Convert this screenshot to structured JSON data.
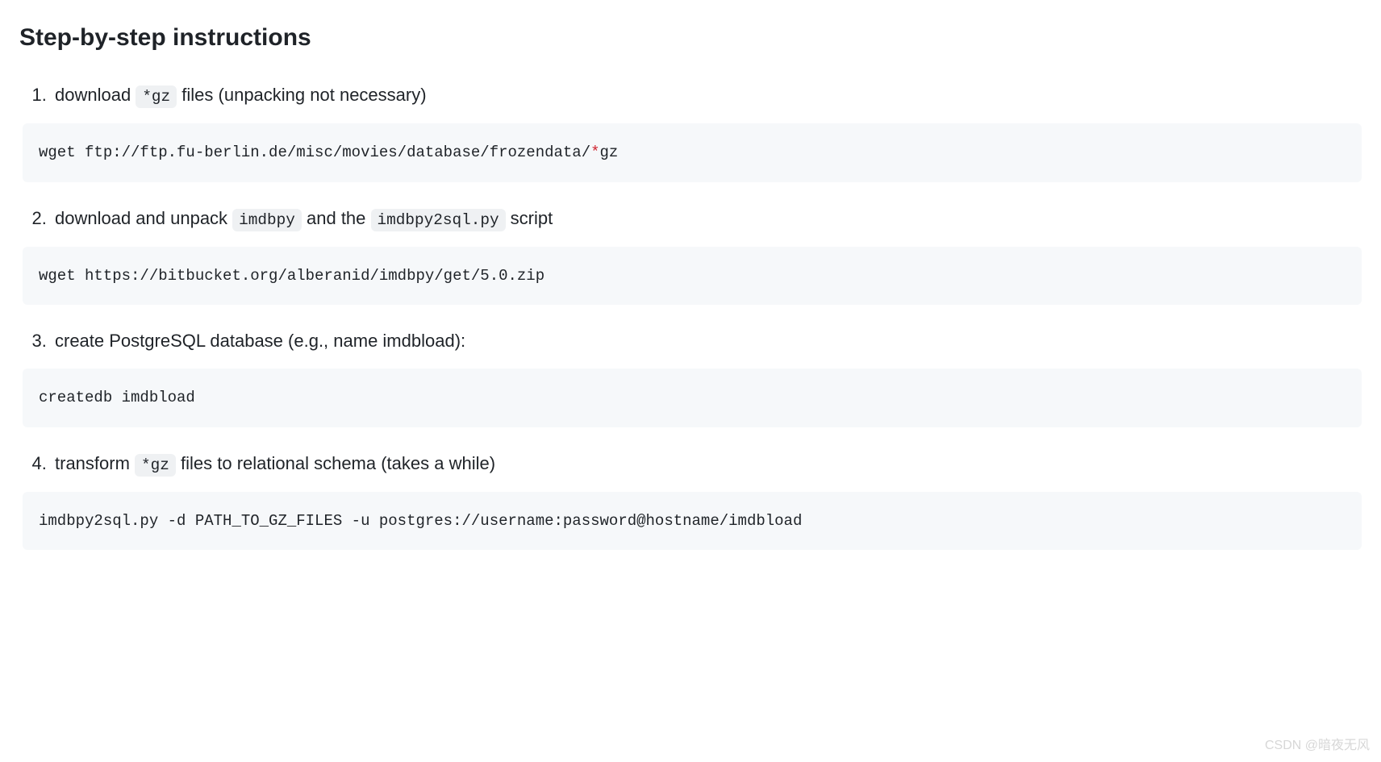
{
  "heading": "Step-by-step instructions",
  "steps": [
    {
      "text_before": "download ",
      "code1": "*gz",
      "text_mid1": " files (unpacking not necessary)",
      "code2": "",
      "text_after": "",
      "block_plain1": "wget ftp://ftp.fu-berlin.de/misc/movies/database/frozendata/",
      "block_red": "*",
      "block_plain2": "gz"
    },
    {
      "text_before": "download and unpack ",
      "code1": "imdbpy",
      "text_mid1": " and the ",
      "code2": "imdbpy2sql.py",
      "text_after": " script",
      "block_plain1": "wget https://bitbucket.org/alberanid/imdbpy/get/5.0.zip",
      "block_red": "",
      "block_plain2": ""
    },
    {
      "text_before": "create PostgreSQL database (e.g., name imdbload):",
      "code1": "",
      "text_mid1": "",
      "code2": "",
      "text_after": "",
      "block_plain1": "createdb imdbload",
      "block_red": "",
      "block_plain2": ""
    },
    {
      "text_before": "transform ",
      "code1": "*gz",
      "text_mid1": " files to relational schema (takes a while)",
      "code2": "",
      "text_after": "",
      "block_plain1": "imdbpy2sql.py -d PATH_TO_GZ_FILES -u postgres://username:password@hostname/imdbload",
      "block_red": "",
      "block_plain2": ""
    }
  ],
  "watermark": "CSDN @暗夜无风"
}
